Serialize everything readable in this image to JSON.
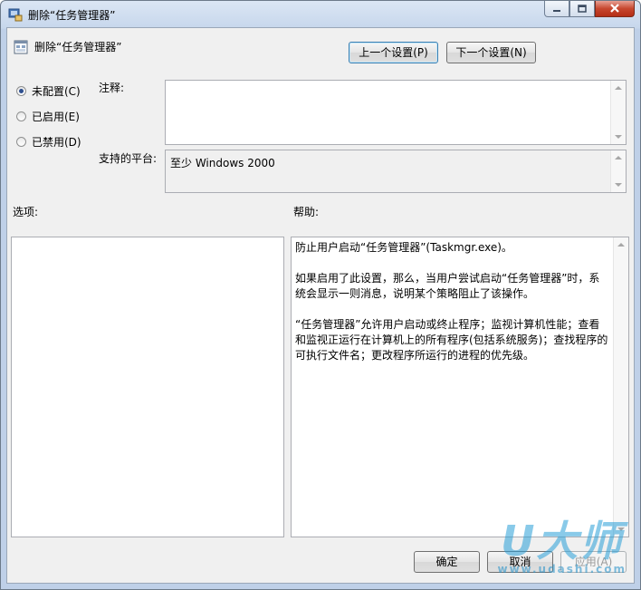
{
  "window": {
    "title": "删除“任务管理器”",
    "icons": {
      "app": "policy-window-icon",
      "minimize": "minimize-icon",
      "maximize": "maximize-icon",
      "close": "close-icon"
    }
  },
  "header": {
    "policy_icon": "policy-setting-icon",
    "policy_name": "删除“任务管理器”",
    "prev_button": "上一个设置(P)",
    "next_button": "下一个设置(N)"
  },
  "state": {
    "options": [
      {
        "label": "未配置(C)",
        "checked": true
      },
      {
        "label": "已启用(E)",
        "checked": false
      },
      {
        "label": "已禁用(D)",
        "checked": false
      }
    ]
  },
  "comment": {
    "label": "注释:",
    "value": ""
  },
  "platform": {
    "label": "支持的平台:",
    "value": "至少 Windows 2000"
  },
  "options_panel": {
    "label": "选项:"
  },
  "help_panel": {
    "label": "帮助:",
    "paragraphs": [
      "防止用户启动“任务管理器”(Taskmgr.exe)。",
      "如果启用了此设置，那么，当用户尝试启动“任务管理器”时，系统会显示一则消息，说明某个策略阻止了该操作。",
      "“任务管理器”允许用户启动或终止程序；监视计算机性能；查看和监视正运行在计算机上的所有程序(包括系统服务)；查找程序的可执行文件名；更改程序所运行的进程的优先级。"
    ]
  },
  "footer": {
    "ok_button": "确定",
    "cancel_button": "取消",
    "apply_button": "应用(A)"
  },
  "watermark": {
    "logo": "U大师",
    "url": "www.udashi.com"
  },
  "colors": {
    "accent": "#3c7fb1",
    "close": "#c7472f",
    "watermark": "#2a9fd8"
  }
}
